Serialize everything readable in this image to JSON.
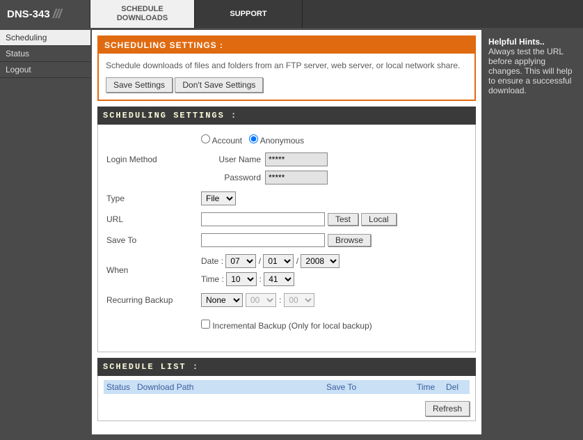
{
  "header": {
    "product": "DNS-343",
    "tabs": {
      "schedule": "SCHEDULE DOWNLOADS",
      "support": "SUPPORT"
    }
  },
  "sidebar": {
    "items": [
      {
        "label": "Scheduling"
      },
      {
        "label": "Status"
      },
      {
        "label": "Logout"
      }
    ]
  },
  "orange": {
    "title": "SCHEDULING SETTINGS :",
    "desc": "Schedule downloads of files and folders from an FTP server, web server, or local network share.",
    "save": "Save Settings",
    "dont": "Don't Save Settings"
  },
  "form": {
    "title": "SCHEDULING SETTINGS :",
    "login_label": "Login Method",
    "account": "Account",
    "anonymous": "Anonymous",
    "user_label": "User Name",
    "user_value": "*****",
    "pass_label": "Password",
    "pass_value": "*****",
    "type_label": "Type",
    "type_value": "File",
    "url_label": "URL",
    "url_value": "",
    "test": "Test",
    "local": "Local",
    "save_to_label": "Save To",
    "save_to_value": "",
    "browse": "Browse",
    "when_label": "When",
    "date_label": "Date :",
    "month": "07",
    "day": "01",
    "year": "2008",
    "time_label": "Time :",
    "hour": "10",
    "minute": "41",
    "recurring_label": "Recurring Backup",
    "recurring_value": "None",
    "rb_hour": "00",
    "rb_min": "00",
    "incremental": "Incremental Backup (Only for local backup)"
  },
  "list": {
    "title": "SCHEDULE LIST :",
    "th_status": "Status",
    "th_path": "Download Path",
    "th_saveto": "Save To",
    "th_time": "Time",
    "th_del": "Del",
    "refresh": "Refresh"
  },
  "hints": {
    "title": "Helpful Hints..",
    "body": "Always test the URL before applying changes. This will help to ensure a successful download."
  }
}
